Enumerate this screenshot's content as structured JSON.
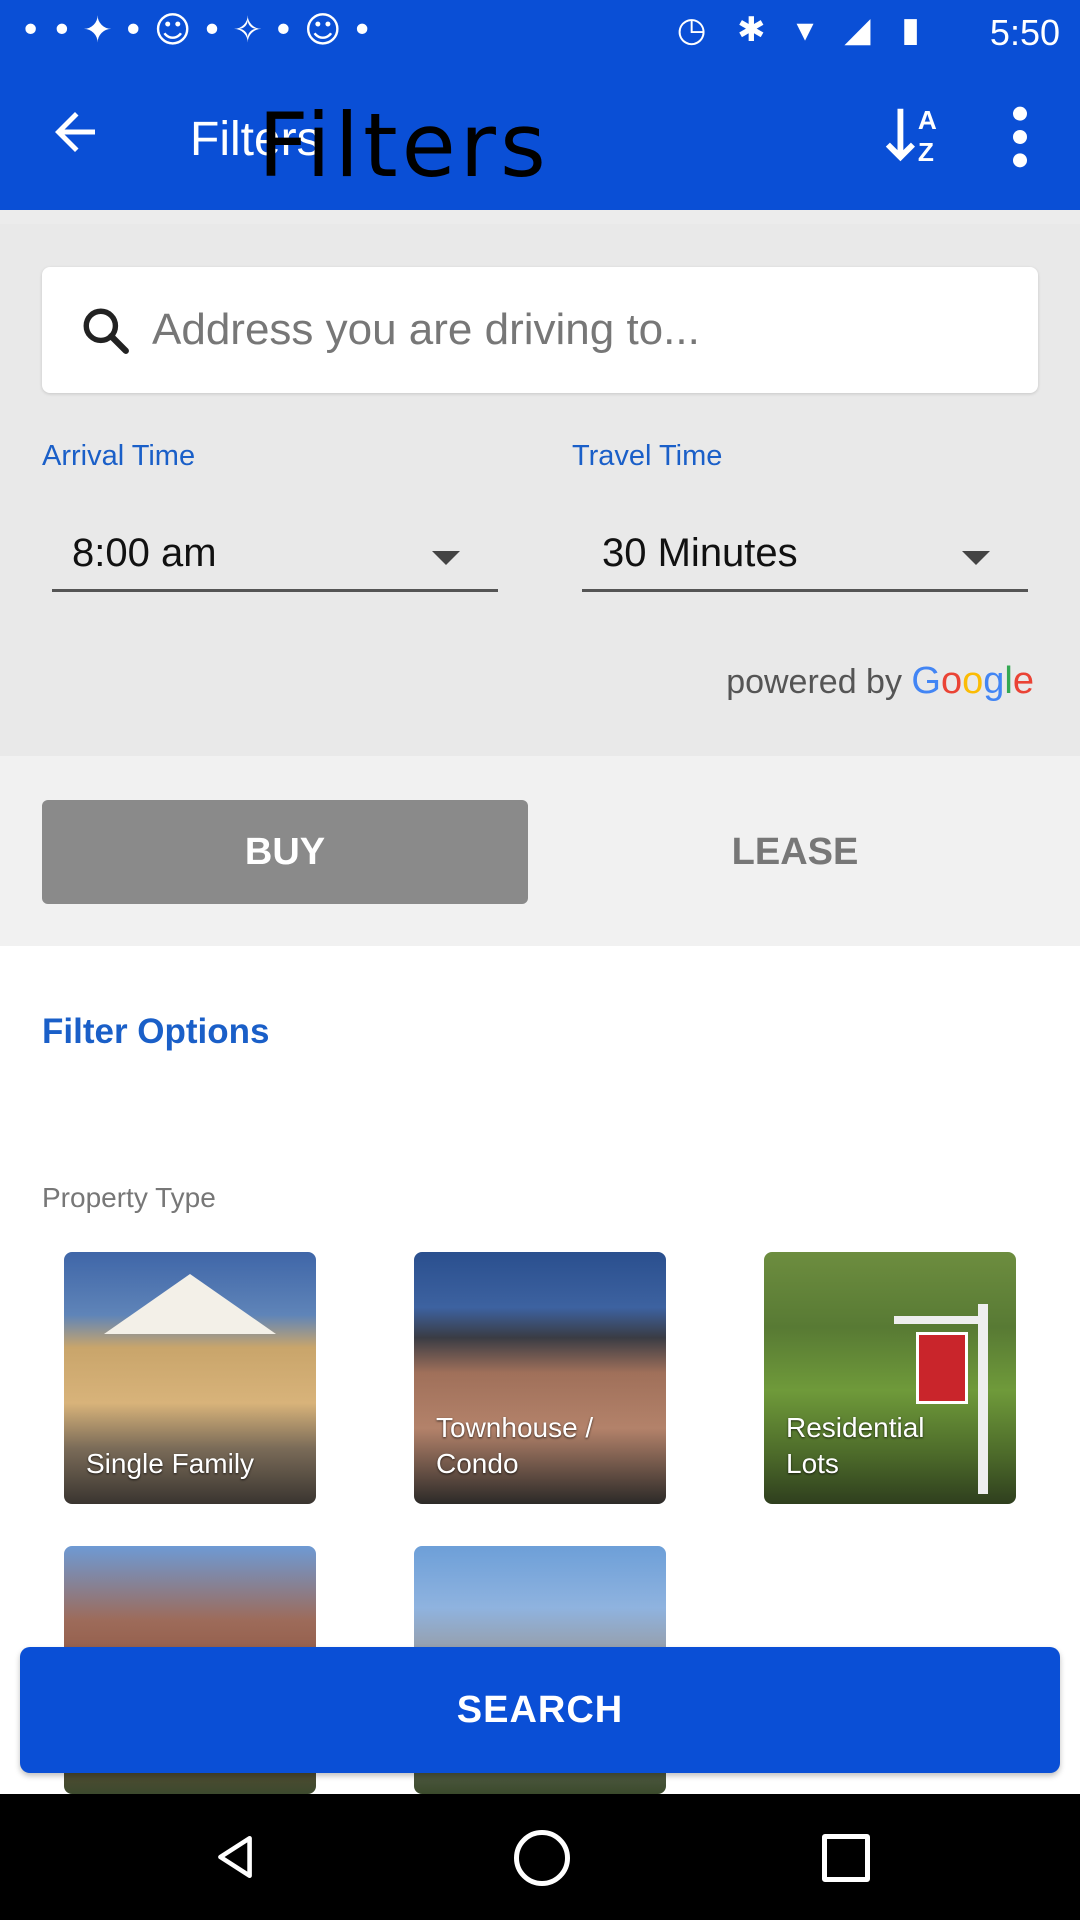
{
  "status_bar": {
    "time": "5:50",
    "notification_icons": "••✦•☺•✧•☺•",
    "system_icons": "◷ ✱ ▾ ◢ ▮"
  },
  "app_bar": {
    "title": "Filters",
    "overlay_title": "Filters",
    "back_icon": "arrow-left",
    "sort_icon": "sort-az",
    "more_icon": "more-vertical"
  },
  "search": {
    "placeholder": "Address you are driving to...",
    "value": ""
  },
  "arrival": {
    "label": "Arrival Time",
    "value": "8:00 am"
  },
  "travel": {
    "label": "Travel Time",
    "value": "30 Minutes"
  },
  "powered_by": {
    "prefix": "powered by",
    "brand": "Google"
  },
  "toggle": {
    "buy": "BUY",
    "lease": "LEASE",
    "selected": "BUY"
  },
  "filter_options": {
    "title": "Filter Options",
    "property_type_label": "Property Type",
    "tiles": [
      {
        "label": "Single Family"
      },
      {
        "label": "Townhouse / Condo"
      },
      {
        "label": "Residential Lots"
      }
    ]
  },
  "search_button": {
    "label": "SEARCH"
  },
  "colors": {
    "primary": "#0a4fd6",
    "accent_text": "#1a5fc8",
    "selected_toggle": "#8a8a8a"
  }
}
